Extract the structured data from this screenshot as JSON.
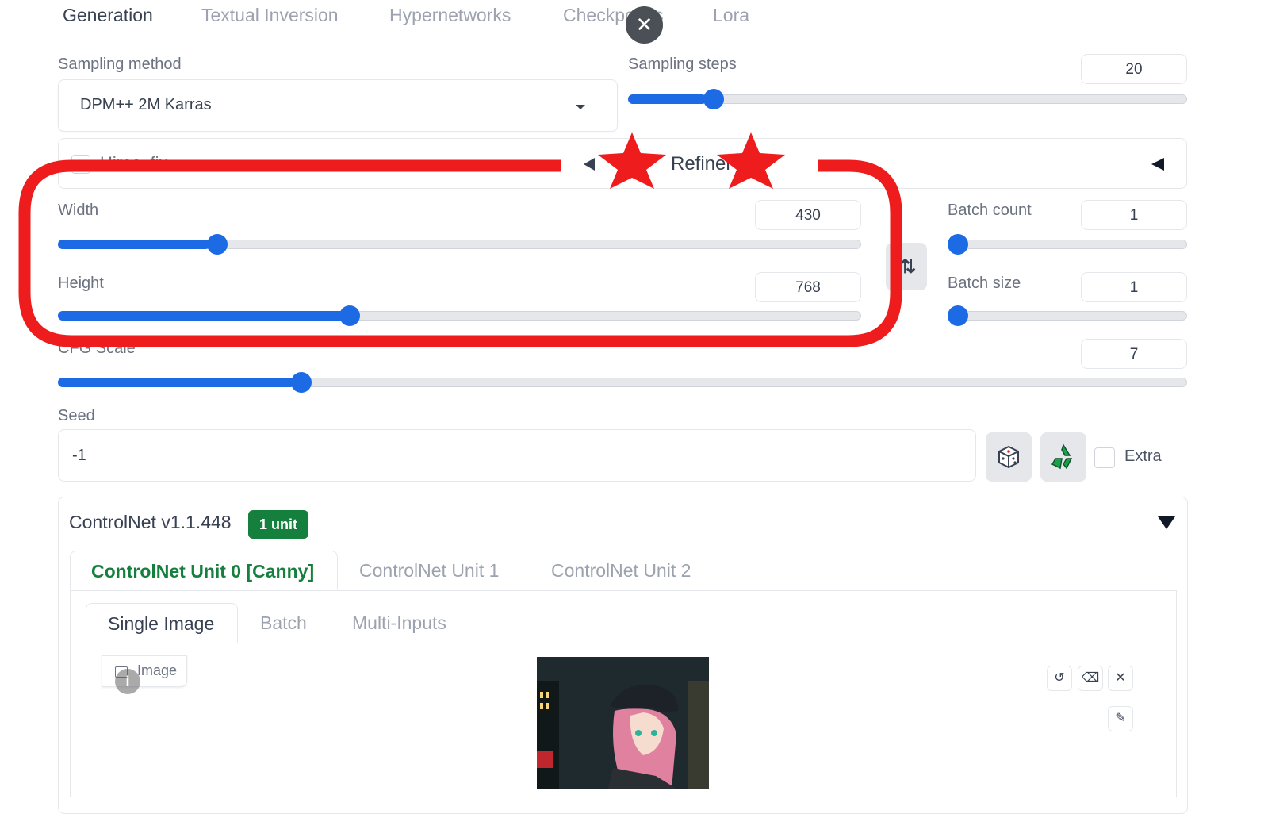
{
  "top_tabs": [
    "Generation",
    "Textual Inversion",
    "Hypernetworks",
    "Checkpoints",
    "Lora"
  ],
  "sampling": {
    "method_label": "Sampling method",
    "method_value": "DPM++ 2M Karras",
    "steps_label": "Sampling steps",
    "steps_value": "20",
    "steps_fraction": 0.14
  },
  "accordion": {
    "checkbox_label": "Hires. fix",
    "refiner_label": "Refiner"
  },
  "width": {
    "label": "Width",
    "value": "430",
    "fraction": 0.19
  },
  "height": {
    "label": "Height",
    "value": "768",
    "fraction": 0.36
  },
  "batch_count": {
    "label": "Batch count",
    "value": "1",
    "fraction": 0.0
  },
  "batch_size": {
    "label": "Batch size",
    "value": "1",
    "fraction": 0.0
  },
  "cfg": {
    "label": "CFG Scale",
    "value": "7",
    "fraction": 0.21
  },
  "seed": {
    "label": "Seed",
    "value": "-1",
    "extra_label": "Extra"
  },
  "controlnet": {
    "title": "ControlNet v1.1.448",
    "badge": "1 unit",
    "unit_tabs": [
      "ControlNet Unit 0 [Canny]",
      "ControlNet Unit 1",
      "ControlNet Unit 2"
    ],
    "image_tabs": [
      "Single Image",
      "Batch",
      "Multi-Inputs"
    ],
    "image_label": "Image"
  },
  "colors": {
    "accent_blue": "#1d6ae5",
    "green": "#15803d",
    "annotation_red": "#ee1c1c"
  },
  "icons": [
    "close-icon",
    "dice-icon",
    "recycle-icon",
    "swap-icon",
    "undo-icon",
    "eraser-icon",
    "x-icon",
    "brush-icon",
    "info-icon",
    "image-icon",
    "star-icon"
  ]
}
